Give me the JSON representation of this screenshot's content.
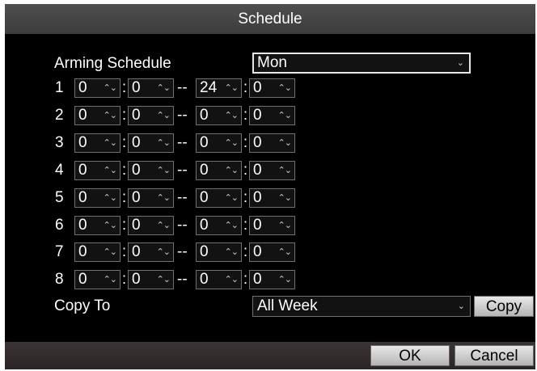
{
  "title": "Schedule",
  "arming": {
    "label": "Arming Schedule",
    "day": "Mon"
  },
  "rows": [
    {
      "num": "1",
      "sh": "0",
      "sm": "0",
      "eh": "24",
      "em": "0"
    },
    {
      "num": "2",
      "sh": "0",
      "sm": "0",
      "eh": "0",
      "em": "0"
    },
    {
      "num": "3",
      "sh": "0",
      "sm": "0",
      "eh": "0",
      "em": "0"
    },
    {
      "num": "4",
      "sh": "0",
      "sm": "0",
      "eh": "0",
      "em": "0"
    },
    {
      "num": "5",
      "sh": "0",
      "sm": "0",
      "eh": "0",
      "em": "0"
    },
    {
      "num": "6",
      "sh": "0",
      "sm": "0",
      "eh": "0",
      "em": "0"
    },
    {
      "num": "7",
      "sh": "0",
      "sm": "0",
      "eh": "0",
      "em": "0"
    },
    {
      "num": "8",
      "sh": "0",
      "sm": "0",
      "eh": "0",
      "em": "0"
    }
  ],
  "separators": {
    "colon": ":",
    "dash": "--"
  },
  "copy": {
    "label": "Copy To",
    "target": "All Week",
    "button": "Copy"
  },
  "footer": {
    "ok": "OK",
    "cancel": "Cancel"
  },
  "icons": {
    "dropdown": "chevron-down-icon",
    "spinner": "up-down-arrows-icon"
  },
  "colors": {
    "background": "#000000",
    "titlebar": "#444444",
    "button": "#d0d0d0",
    "focus_border": "#e8e8e8"
  }
}
